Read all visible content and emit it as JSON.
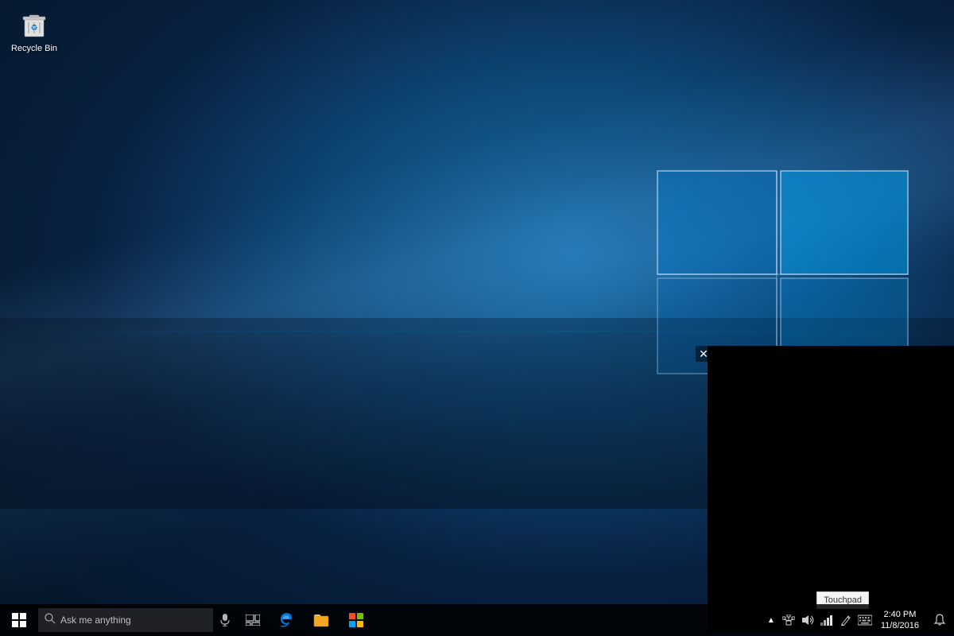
{
  "desktop": {
    "recycle_bin": {
      "label": "Recycle Bin"
    },
    "black_panel": {
      "visible": true
    },
    "touchpad_tooltip": "Touchpad"
  },
  "taskbar": {
    "start_label": "Start",
    "search_placeholder": "Ask me anything",
    "clock": {
      "time": "2:40 PM",
      "date": "11/8/2016"
    },
    "apps": [
      {
        "name": "task-view",
        "icon": "⧉"
      },
      {
        "name": "edge",
        "icon": "e"
      },
      {
        "name": "file-explorer",
        "icon": "📁"
      },
      {
        "name": "store",
        "icon": "🛍"
      }
    ],
    "tray": {
      "chevron": "^",
      "icons": [
        "network",
        "volume",
        "wifi",
        "pen",
        "keyboard"
      ]
    }
  }
}
